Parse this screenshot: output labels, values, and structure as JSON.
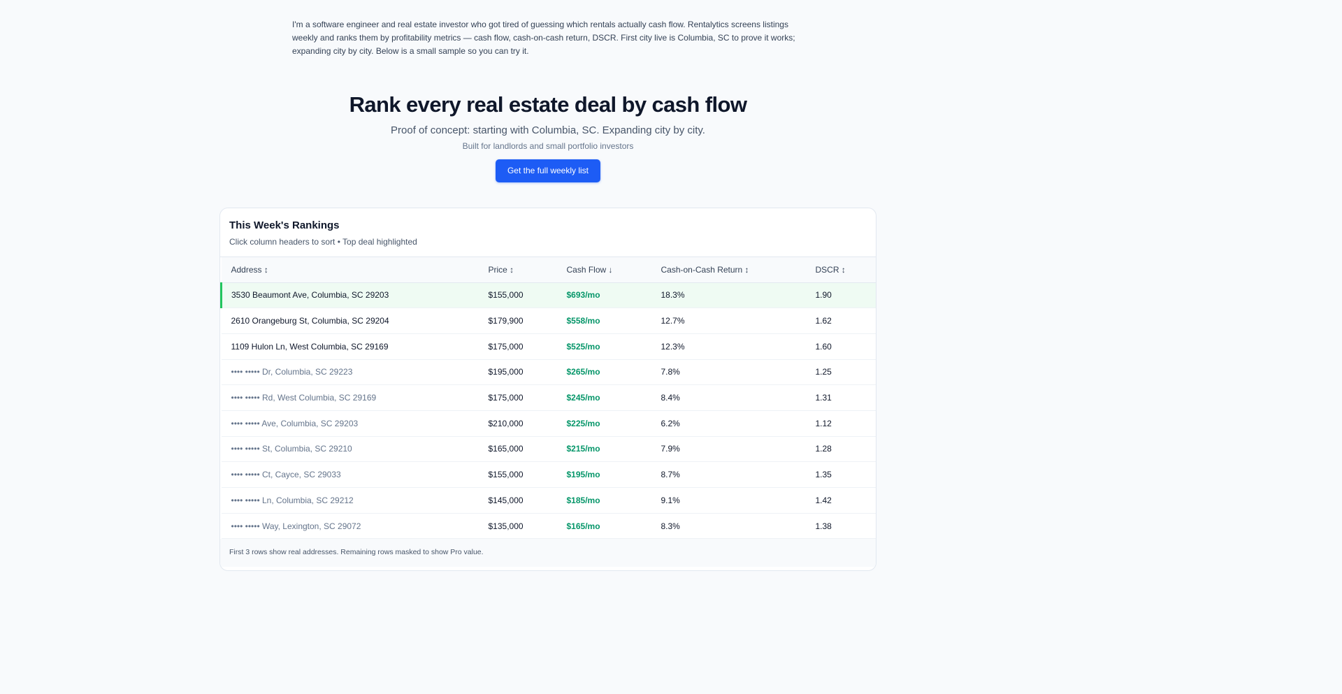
{
  "intro": "I'm a software engineer and real estate investor who got tired of guessing which rentals actually cash flow. Rentalytics screens listings weekly and ranks them by profitability metrics — cash flow, cash-on-cash return, DSCR. First city live is Columbia, SC to prove it works; expanding city by city. Below is a small sample so you can try it.",
  "hero": {
    "title": "Rank every real estate deal by cash flow",
    "subtitle": "Proof of concept: starting with Columbia, SC. Expanding city by city.",
    "audience": "Built for landlords and small portfolio investors",
    "cta_label": "Get the full weekly list"
  },
  "rankings": {
    "title": "This Week's Rankings",
    "subtitle": "Click column headers to sort • Top deal highlighted",
    "columns": [
      "Address ↕",
      "Price ↕",
      "Cash Flow ↓",
      "Cash-on-Cash Return ↕",
      "DSCR ↕"
    ],
    "rows": [
      {
        "address": "3530 Beaumont Ave, Columbia, SC 29203",
        "price": "$155,000",
        "cash_flow": "$693/mo",
        "coc": "18.3%",
        "dscr": "1.90"
      },
      {
        "address": "2610 Orangeburg St, Columbia, SC 29204",
        "price": "$179,900",
        "cash_flow": "$558/mo",
        "coc": "12.7%",
        "dscr": "1.62"
      },
      {
        "address": "1109 Hulon Ln, West Columbia, SC 29169",
        "price": "$175,000",
        "cash_flow": "$525/mo",
        "coc": "12.3%",
        "dscr": "1.60"
      },
      {
        "address": "•••• ••••• Dr, Columbia, SC 29223",
        "price": "$195,000",
        "cash_flow": "$265/mo",
        "coc": "7.8%",
        "dscr": "1.25"
      },
      {
        "address": "•••• ••••• Rd, West Columbia, SC 29169",
        "price": "$175,000",
        "cash_flow": "$245/mo",
        "coc": "8.4%",
        "dscr": "1.31"
      },
      {
        "address": "•••• ••••• Ave, Columbia, SC 29203",
        "price": "$210,000",
        "cash_flow": "$225/mo",
        "coc": "6.2%",
        "dscr": "1.12"
      },
      {
        "address": "•••• ••••• St, Columbia, SC 29210",
        "price": "$165,000",
        "cash_flow": "$215/mo",
        "coc": "7.9%",
        "dscr": "1.28"
      },
      {
        "address": "•••• ••••• Ct, Cayce, SC 29033",
        "price": "$155,000",
        "cash_flow": "$195/mo",
        "coc": "8.7%",
        "dscr": "1.35"
      },
      {
        "address": "•••• ••••• Ln, Columbia, SC 29212",
        "price": "$145,000",
        "cash_flow": "$185/mo",
        "coc": "9.1%",
        "dscr": "1.42"
      },
      {
        "address": "•••• ••••• Way, Lexington, SC 29072",
        "price": "$135,000",
        "cash_flow": "$165/mo",
        "coc": "8.3%",
        "dscr": "1.38"
      }
    ],
    "footnote": "First 3 rows show real addresses. Remaining rows masked to show Pro value."
  },
  "colors": {
    "accent": "#1d5cf5",
    "cash_flow": "#059669",
    "top_highlight": "#22c55e",
    "top_row_bg": "#effbf3"
  }
}
